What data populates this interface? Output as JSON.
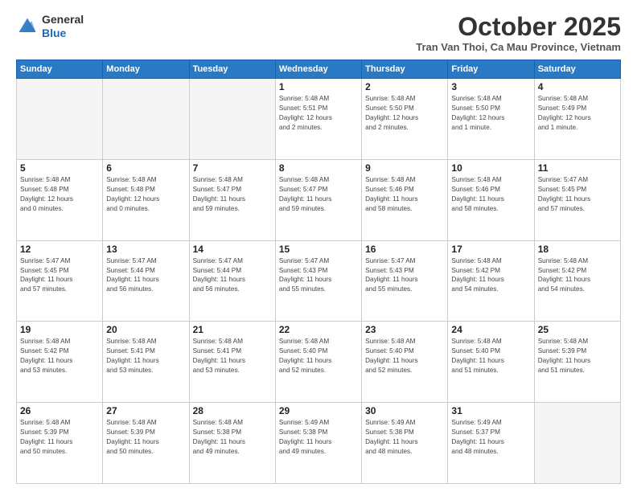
{
  "header": {
    "logo": {
      "general": "General",
      "blue": "Blue"
    },
    "title": "October 2025",
    "subtitle": "Tran Van Thoi, Ca Mau Province, Vietnam"
  },
  "calendar": {
    "days_of_week": [
      "Sunday",
      "Monday",
      "Tuesday",
      "Wednesday",
      "Thursday",
      "Friday",
      "Saturday"
    ],
    "weeks": [
      [
        {
          "day": "",
          "info": ""
        },
        {
          "day": "",
          "info": ""
        },
        {
          "day": "",
          "info": ""
        },
        {
          "day": "1",
          "info": "Sunrise: 5:48 AM\nSunset: 5:51 PM\nDaylight: 12 hours\nand 2 minutes."
        },
        {
          "day": "2",
          "info": "Sunrise: 5:48 AM\nSunset: 5:50 PM\nDaylight: 12 hours\nand 2 minutes."
        },
        {
          "day": "3",
          "info": "Sunrise: 5:48 AM\nSunset: 5:50 PM\nDaylight: 12 hours\nand 1 minute."
        },
        {
          "day": "4",
          "info": "Sunrise: 5:48 AM\nSunset: 5:49 PM\nDaylight: 12 hours\nand 1 minute."
        }
      ],
      [
        {
          "day": "5",
          "info": "Sunrise: 5:48 AM\nSunset: 5:48 PM\nDaylight: 12 hours\nand 0 minutes."
        },
        {
          "day": "6",
          "info": "Sunrise: 5:48 AM\nSunset: 5:48 PM\nDaylight: 12 hours\nand 0 minutes."
        },
        {
          "day": "7",
          "info": "Sunrise: 5:48 AM\nSunset: 5:47 PM\nDaylight: 11 hours\nand 59 minutes."
        },
        {
          "day": "8",
          "info": "Sunrise: 5:48 AM\nSunset: 5:47 PM\nDaylight: 11 hours\nand 59 minutes."
        },
        {
          "day": "9",
          "info": "Sunrise: 5:48 AM\nSunset: 5:46 PM\nDaylight: 11 hours\nand 58 minutes."
        },
        {
          "day": "10",
          "info": "Sunrise: 5:48 AM\nSunset: 5:46 PM\nDaylight: 11 hours\nand 58 minutes."
        },
        {
          "day": "11",
          "info": "Sunrise: 5:47 AM\nSunset: 5:45 PM\nDaylight: 11 hours\nand 57 minutes."
        }
      ],
      [
        {
          "day": "12",
          "info": "Sunrise: 5:47 AM\nSunset: 5:45 PM\nDaylight: 11 hours\nand 57 minutes."
        },
        {
          "day": "13",
          "info": "Sunrise: 5:47 AM\nSunset: 5:44 PM\nDaylight: 11 hours\nand 56 minutes."
        },
        {
          "day": "14",
          "info": "Sunrise: 5:47 AM\nSunset: 5:44 PM\nDaylight: 11 hours\nand 56 minutes."
        },
        {
          "day": "15",
          "info": "Sunrise: 5:47 AM\nSunset: 5:43 PM\nDaylight: 11 hours\nand 55 minutes."
        },
        {
          "day": "16",
          "info": "Sunrise: 5:47 AM\nSunset: 5:43 PM\nDaylight: 11 hours\nand 55 minutes."
        },
        {
          "day": "17",
          "info": "Sunrise: 5:48 AM\nSunset: 5:42 PM\nDaylight: 11 hours\nand 54 minutes."
        },
        {
          "day": "18",
          "info": "Sunrise: 5:48 AM\nSunset: 5:42 PM\nDaylight: 11 hours\nand 54 minutes."
        }
      ],
      [
        {
          "day": "19",
          "info": "Sunrise: 5:48 AM\nSunset: 5:42 PM\nDaylight: 11 hours\nand 53 minutes."
        },
        {
          "day": "20",
          "info": "Sunrise: 5:48 AM\nSunset: 5:41 PM\nDaylight: 11 hours\nand 53 minutes."
        },
        {
          "day": "21",
          "info": "Sunrise: 5:48 AM\nSunset: 5:41 PM\nDaylight: 11 hours\nand 53 minutes."
        },
        {
          "day": "22",
          "info": "Sunrise: 5:48 AM\nSunset: 5:40 PM\nDaylight: 11 hours\nand 52 minutes."
        },
        {
          "day": "23",
          "info": "Sunrise: 5:48 AM\nSunset: 5:40 PM\nDaylight: 11 hours\nand 52 minutes."
        },
        {
          "day": "24",
          "info": "Sunrise: 5:48 AM\nSunset: 5:40 PM\nDaylight: 11 hours\nand 51 minutes."
        },
        {
          "day": "25",
          "info": "Sunrise: 5:48 AM\nSunset: 5:39 PM\nDaylight: 11 hours\nand 51 minutes."
        }
      ],
      [
        {
          "day": "26",
          "info": "Sunrise: 5:48 AM\nSunset: 5:39 PM\nDaylight: 11 hours\nand 50 minutes."
        },
        {
          "day": "27",
          "info": "Sunrise: 5:48 AM\nSunset: 5:39 PM\nDaylight: 11 hours\nand 50 minutes."
        },
        {
          "day": "28",
          "info": "Sunrise: 5:48 AM\nSunset: 5:38 PM\nDaylight: 11 hours\nand 49 minutes."
        },
        {
          "day": "29",
          "info": "Sunrise: 5:49 AM\nSunset: 5:38 PM\nDaylight: 11 hours\nand 49 minutes."
        },
        {
          "day": "30",
          "info": "Sunrise: 5:49 AM\nSunset: 5:38 PM\nDaylight: 11 hours\nand 48 minutes."
        },
        {
          "day": "31",
          "info": "Sunrise: 5:49 AM\nSunset: 5:37 PM\nDaylight: 11 hours\nand 48 minutes."
        },
        {
          "day": "",
          "info": ""
        }
      ]
    ]
  }
}
